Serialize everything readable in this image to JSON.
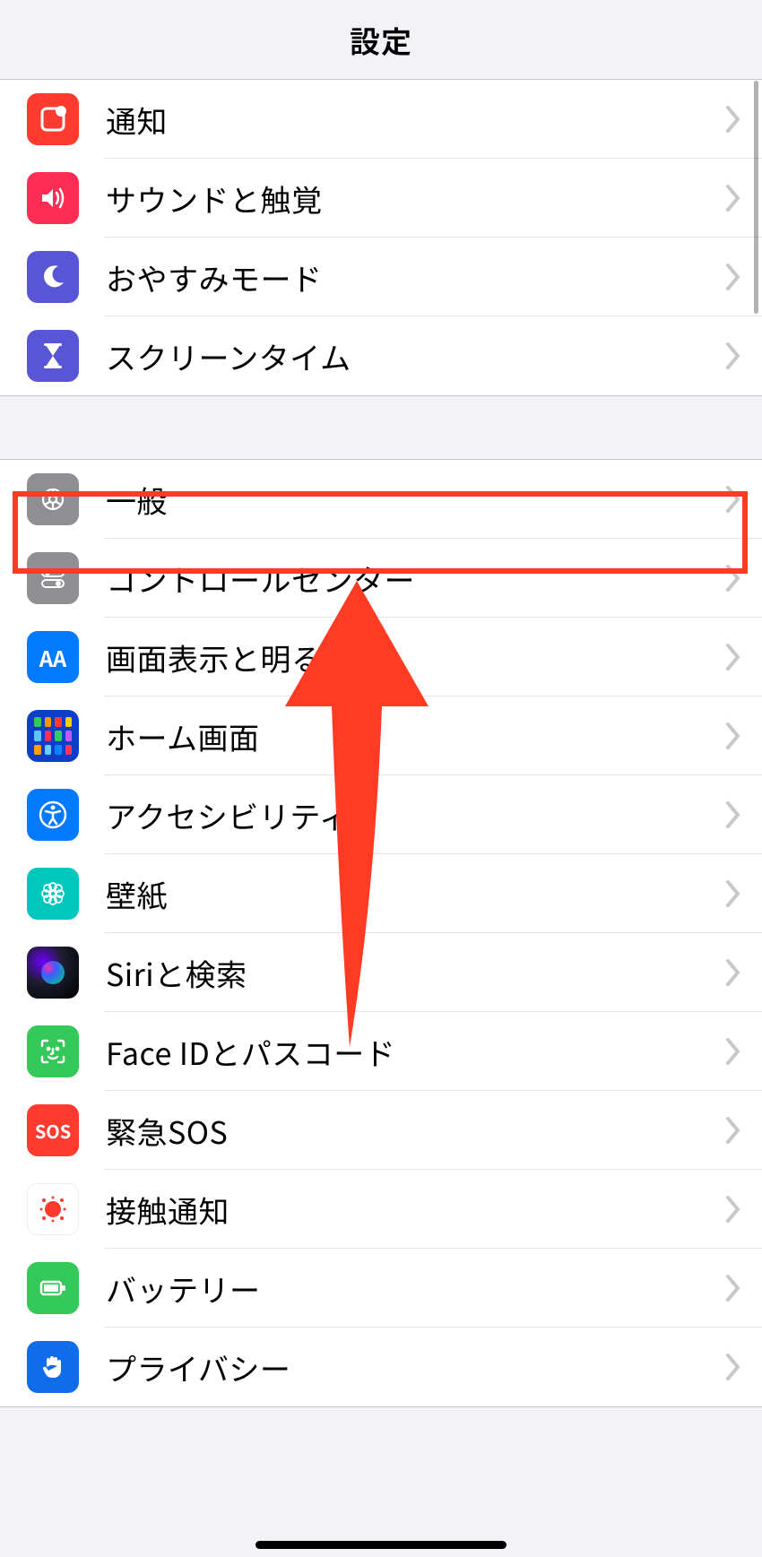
{
  "header": {
    "title": "設定"
  },
  "sections": [
    {
      "rows": [
        {
          "id": "notifications",
          "label": "通知",
          "icon": "notifications-icon",
          "bg": "bg-red"
        },
        {
          "id": "sounds",
          "label": "サウンドと触覚",
          "icon": "sound-icon",
          "bg": "bg-pink"
        },
        {
          "id": "dnd",
          "label": "おやすみモード",
          "icon": "moon-icon",
          "bg": "bg-indigo"
        },
        {
          "id": "screentime",
          "label": "スクリーンタイム",
          "icon": "hourglass-icon",
          "bg": "bg-indigo"
        }
      ]
    },
    {
      "rows": [
        {
          "id": "general",
          "label": "一般",
          "icon": "gear-icon",
          "bg": "bg-gray",
          "highlighted": true
        },
        {
          "id": "controlcenter",
          "label": "コントロールセンター",
          "icon": "switches-icon",
          "bg": "bg-gray"
        },
        {
          "id": "display",
          "label": "画面表示と明るさ",
          "icon": "text-size-icon",
          "bg": "bg-blue"
        },
        {
          "id": "homescreen",
          "label": "ホーム画面",
          "icon": "home-grid-icon",
          "bg": "bg-apps"
        },
        {
          "id": "accessibility",
          "label": "アクセシビリティ",
          "icon": "accessibility-icon",
          "bg": "bg-blue"
        },
        {
          "id": "wallpaper",
          "label": "壁紙",
          "icon": "flower-icon",
          "bg": "bg-cyan"
        },
        {
          "id": "siri",
          "label": "Siriと検索",
          "icon": "siri-icon",
          "bg": "siri-grad"
        },
        {
          "id": "faceid",
          "label": "Face IDとパスコード",
          "icon": "face-id-icon",
          "bg": "bg-green"
        },
        {
          "id": "sos",
          "label": "緊急SOS",
          "icon": "sos-icon",
          "bg": "bg-red",
          "icon_text": "SOS"
        },
        {
          "id": "exposure",
          "label": "接触通知",
          "icon": "exposure-icon",
          "bg": "bg-white"
        },
        {
          "id": "battery",
          "label": "バッテリー",
          "icon": "battery-icon",
          "bg": "bg-green"
        },
        {
          "id": "privacy",
          "label": "プライバシー",
          "icon": "hand-icon",
          "bg": "bg-privacy"
        }
      ]
    }
  ],
  "annotations": {
    "highlight_row": "general",
    "arrow_points_to": "general"
  },
  "colors": {
    "highlight": "#FF3B24",
    "arrow": "#FF3B24",
    "page_bg": "#F2F2F7",
    "row_bg": "#FFFFFF",
    "chevron": "#C7C7CC"
  }
}
